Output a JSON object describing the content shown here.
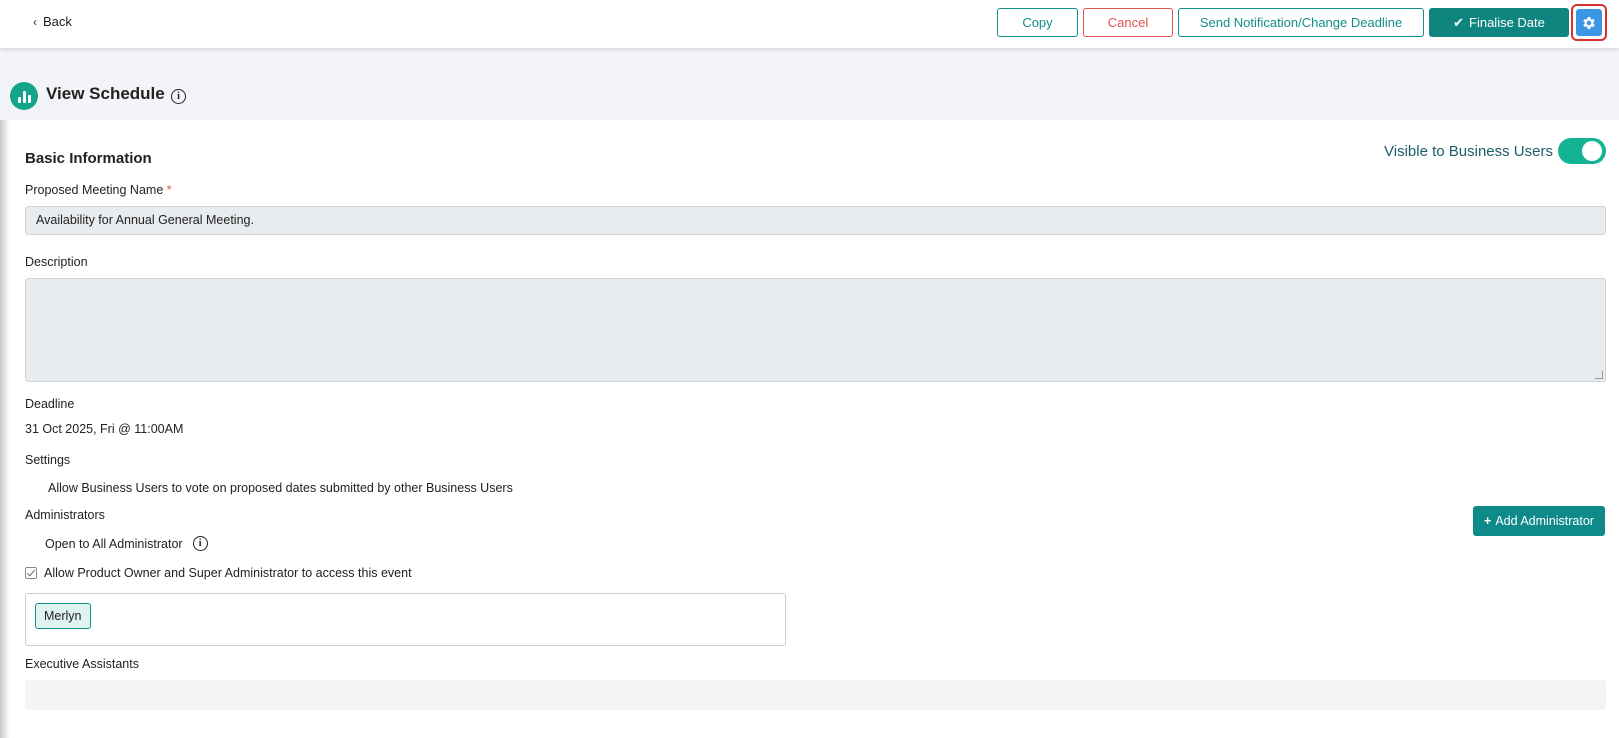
{
  "topbar": {
    "back_label": "Back",
    "buttons": {
      "copy": "Copy",
      "cancel": "Cancel",
      "notify": "Send Notification/Change Deadline",
      "finalise": "Finalise Date"
    },
    "settings_icon": "gear-icon"
  },
  "header": {
    "title": "View Schedule",
    "icon": "bar-chart-icon"
  },
  "basic_info": {
    "section_title": "Basic Information",
    "visible_toggle_label": "Visible to Business Users",
    "visible_toggle_on": true,
    "meeting_name_label": "Proposed Meeting Name",
    "required_mark": "*",
    "meeting_name_value": "Availability for Annual General Meeting.",
    "description_label": "Description",
    "description_value": "",
    "deadline_label": "Deadline",
    "deadline_value": "31 Oct 2025, Fri @ 11:00AM",
    "settings_label": "Settings",
    "settings_text": "Allow Business Users to vote on proposed dates submitted by other Business Users",
    "administrators_label": "Administrators",
    "open_to_all_text": "Open to All Administrator",
    "add_admin_label": "Add Administrator",
    "allow_access_text": "Allow Product Owner and Super Administrator to access this event",
    "admin_tags": [
      "Merlyn"
    ],
    "executive_assistants_label": "Executive Assistants"
  },
  "colors": {
    "teal": "#138d88",
    "cancel_red": "#e0534d",
    "toggle_green": "#14b394",
    "gear_blue": "#3a97e6"
  }
}
